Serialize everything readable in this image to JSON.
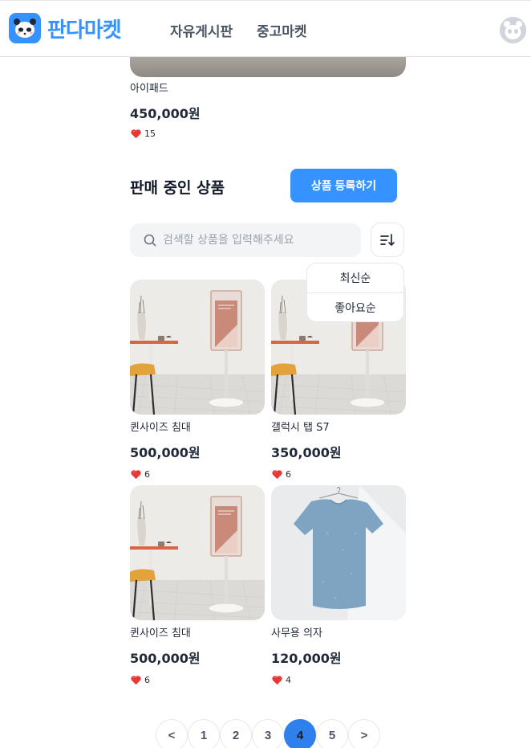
{
  "header": {
    "logo_text": "판다마켓",
    "nav": [
      {
        "label": "자유게시판"
      },
      {
        "label": "중고마켓"
      }
    ]
  },
  "best_item": {
    "name": "아이패드",
    "price": "450,000원",
    "likes": "15"
  },
  "section": {
    "title": "판매 중인 상품",
    "register_label": "상품 등록하기"
  },
  "search": {
    "placeholder": "검색할 상품을 입력해주세요"
  },
  "sort": {
    "options": [
      "최신순",
      "좋아요순"
    ]
  },
  "products": [
    {
      "name": "퀸사이즈 침대",
      "price": "500,000원",
      "likes": "6",
      "image": "stand-display"
    },
    {
      "name": "갤럭시 탭 S7",
      "price": "350,000원",
      "likes": "6",
      "image": "stand-display"
    },
    {
      "name": "퀸사이즈 침대",
      "price": "500,000원",
      "likes": "6",
      "image": "stand-display"
    },
    {
      "name": "사무용 의자",
      "price": "120,000원",
      "likes": "4",
      "image": "tshirt"
    }
  ],
  "pagination": {
    "prev": "<",
    "pages": [
      "1",
      "2",
      "3",
      "4",
      "5"
    ],
    "active": "4",
    "next": ">"
  },
  "colors": {
    "brand": "#3692ff",
    "active_page": "#2f80ed",
    "heart": "#e53935"
  }
}
